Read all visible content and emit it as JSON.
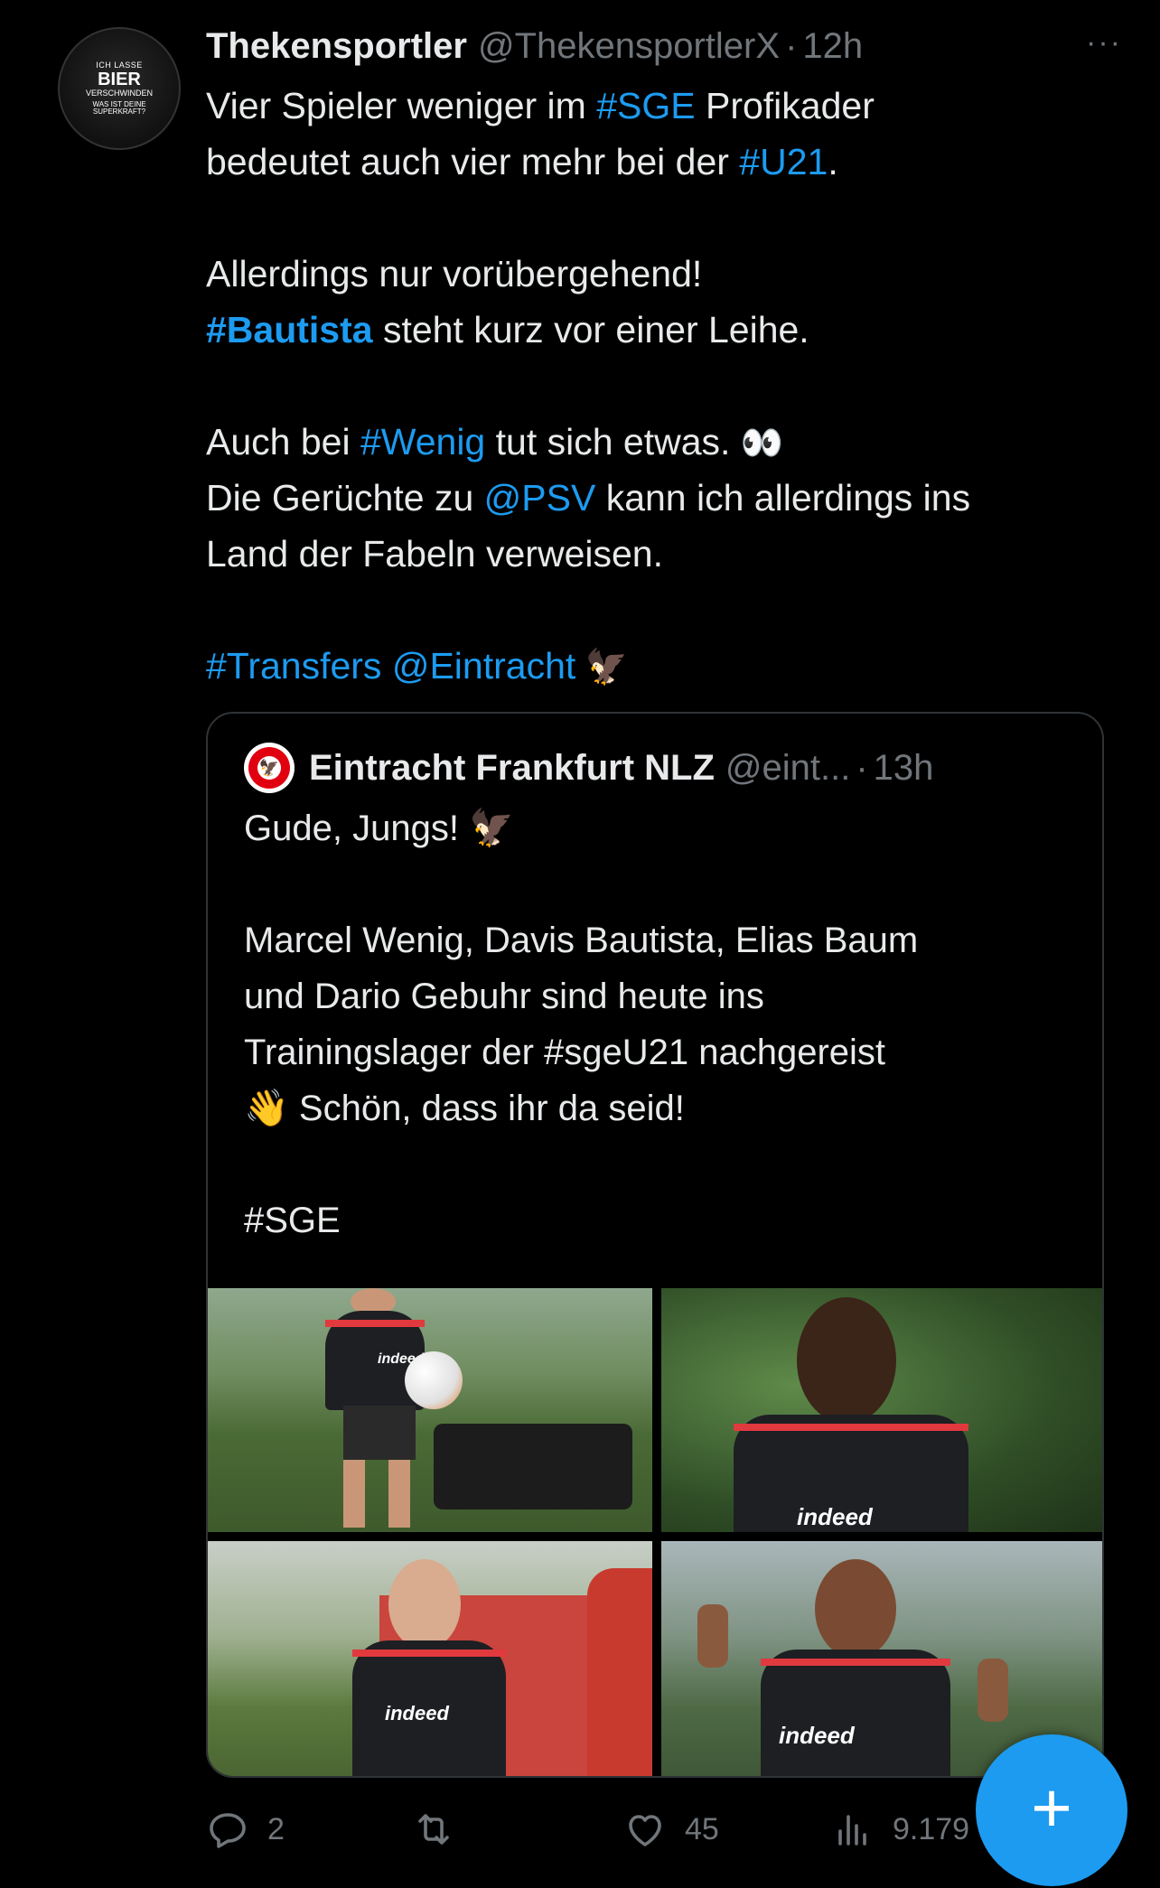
{
  "tweet": {
    "avatar": {
      "lines": [
        "ICH LASSE",
        "BIER",
        "VERSCHWINDEN",
        "WAS IST DEINE",
        "SUPERKRAFT?"
      ]
    },
    "author_name": "Thekensportler",
    "author_handle": "@ThekensportlerX",
    "separator": "·",
    "time": "12h",
    "more_label": "···",
    "text": {
      "l1_a": "Vier Spieler weniger im ",
      "l1_tag": "#SGE",
      "l1_b": " Profikader",
      "l2_a": "bedeutet auch vier mehr bei der ",
      "l2_tag": "#U21",
      "l2_b": ".",
      "l3": "Allerdings nur vorübergehend!",
      "l4_tag": "#Bautista",
      "l4_b": " steht kurz vor einer Leihe.",
      "l5_a": "Auch bei ",
      "l5_tag": "#Wenig",
      "l5_b": " tut sich etwas. ",
      "l5_emoji": "👀",
      "l6_a": "Die Gerüchte zu ",
      "l6_mention": "@PSV",
      "l6_b": " kann ich allerdings ins",
      "l7": "Land der Fabeln verweisen.",
      "l8_tag": "#Transfers",
      "l8_space": " ",
      "l8_mention": "@Eintracht",
      "l8_emoji": " 🦅"
    }
  },
  "quote": {
    "author_name": "Eintracht Frankfurt NLZ",
    "author_handle": "@eint...",
    "separator": "·",
    "time": "13h",
    "text": {
      "l1": "Gude, Jungs! 🦅",
      "l2": "Marcel Wenig, Davis Bautista, Elias Baum",
      "l3": "und Dario Gebuhr sind heute ins",
      "l4": "Trainingslager der #sgeU21 nachgereist",
      "l5": "👋 Schön, dass ihr da seid!",
      "l6": "#SGE"
    },
    "photo_brand": "indeed"
  },
  "actions": {
    "reply_count": "2",
    "retweet_count": "",
    "like_count": "45",
    "views_count": "9.179"
  },
  "fab": {
    "label": "+"
  },
  "colors": {
    "background": "#000000",
    "text": "#e7e9ea",
    "muted": "#71767b",
    "accent": "#1d9bf0",
    "border": "#2f3336"
  }
}
